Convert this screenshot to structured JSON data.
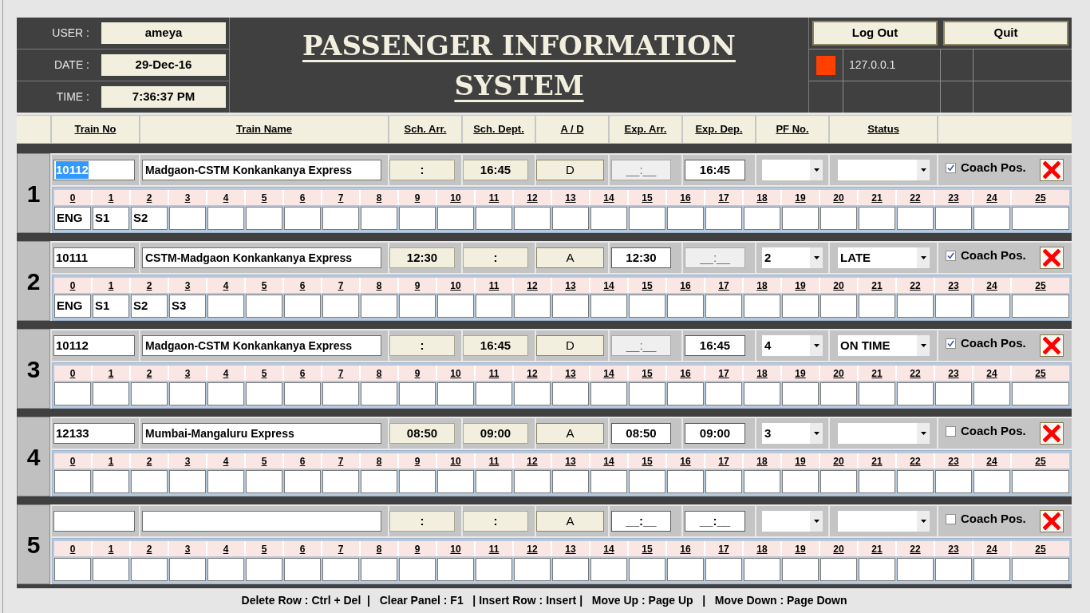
{
  "session": [
    {
      "label": "USER :",
      "value": "ameya"
    },
    {
      "label": "DATE :",
      "value": "29-Dec-16"
    },
    {
      "label": "TIME :",
      "value": "7:36:37 PM"
    }
  ],
  "title": "PASSENGER INFORMATION SYSTEM",
  "buttons": [
    "Log Out",
    "Quit"
  ],
  "server_address": "127.0.0.1",
  "columns": [
    "Train No",
    "Train Name",
    "Sch. Arr.",
    "Sch. Dept.",
    "A / D",
    "Exp. Arr.",
    "Exp. Dep.",
    "PF No.",
    "Status"
  ],
  "trains": [
    {
      "row_number": "1",
      "train_no": {
        "value": "10112",
        "highlighted": true
      },
      "train_name": "Madgaon-CSTM Konkankanya Express",
      "sch_arr": ":",
      "sch_dept": "16:45",
      "arrival_departure": "D",
      "exp_arr": {
        "value": "__:__",
        "disabled": true
      },
      "exp_dep": {
        "value": "16:45",
        "disabled": false
      },
      "coach_pos": {
        "label": "Coach Pos.",
        "checked": true
      },
      "coach_numbers": [
        "0",
        "1",
        "2",
        "3",
        "4",
        "5",
        "6",
        "7",
        "8",
        "9",
        "10",
        "11",
        "12",
        "13",
        "14",
        "15",
        "16",
        "17",
        "18",
        "19",
        "20",
        "21",
        "22",
        "23",
        "24",
        "25"
      ],
      "coaches": [
        "ENG",
        "S1",
        "S2"
      ]
    },
    {
      "row_number": "2",
      "train_no": {
        "value": "10111",
        "highlighted": false
      },
      "train_name": "CSTM-Madgaon Konkankanya Express",
      "sch_arr": "12:30",
      "sch_dept": ":",
      "arrival_departure": "A",
      "exp_arr": {
        "value": "12:30",
        "disabled": false
      },
      "exp_dep": {
        "value": "__:__",
        "disabled": true
      },
      "pf_no": "2",
      "status": "LATE",
      "coach_pos": {
        "label": "Coach Pos.",
        "checked": true
      },
      "coach_numbers": [
        "0",
        "1",
        "2",
        "3",
        "4",
        "5",
        "6",
        "7",
        "8",
        "9",
        "10",
        "11",
        "12",
        "13",
        "14",
        "15",
        "16",
        "17",
        "18",
        "19",
        "20",
        "21",
        "22",
        "23",
        "24",
        "25"
      ],
      "coaches": [
        "ENG",
        "S1",
        "S2",
        "S3"
      ]
    },
    {
      "row_number": "3",
      "train_no": {
        "value": "10112",
        "highlighted": false
      },
      "train_name": "Madgaon-CSTM Konkankanya Express",
      "sch_arr": ":",
      "sch_dept": "16:45",
      "arrival_departure": "D",
      "exp_arr": {
        "value": "__:__",
        "disabled": true
      },
      "exp_dep": {
        "value": "16:45",
        "disabled": false
      },
      "pf_no": "4",
      "status": "ON TIME",
      "coach_pos": {
        "label": "Coach Pos.",
        "checked": true
      },
      "coach_numbers": [
        "0",
        "1",
        "2",
        "3",
        "4",
        "5",
        "6",
        "7",
        "8",
        "9",
        "10",
        "11",
        "12",
        "13",
        "14",
        "15",
        "16",
        "17",
        "18",
        "19",
        "20",
        "21",
        "22",
        "23",
        "24",
        "25"
      ]
    },
    {
      "row_number": "4",
      "train_no": {
        "value": "12133",
        "highlighted": false
      },
      "train_name": "Mumbai-Mangaluru Express",
      "sch_arr": "08:50",
      "sch_dept": "09:00",
      "arrival_departure": "A",
      "exp_arr": {
        "value": "08:50",
        "disabled": false
      },
      "exp_dep": {
        "value": "09:00",
        "disabled": false
      },
      "pf_no": "3",
      "coach_pos": {
        "label": "Coach Pos.",
        "checked": false
      },
      "coach_numbers": [
        "0",
        "1",
        "2",
        "3",
        "4",
        "5",
        "6",
        "7",
        "8",
        "9",
        "10",
        "11",
        "12",
        "13",
        "14",
        "15",
        "16",
        "17",
        "18",
        "19",
        "20",
        "21",
        "22",
        "23",
        "24",
        "25"
      ]
    },
    {
      "row_number": "5",
      "sch_arr": ":",
      "sch_dept": ":",
      "arrival_departure": "A",
      "exp_arr": {
        "value": "__:__",
        "disabled": false
      },
      "exp_dep": {
        "value": "__:__",
        "disabled": false
      },
      "coach_pos": {
        "label": "Coach Pos.",
        "checked": false
      },
      "coach_numbers": [
        "0",
        "1",
        "2",
        "3",
        "4",
        "5",
        "6",
        "7",
        "8",
        "9",
        "10",
        "11",
        "12",
        "13",
        "14",
        "15",
        "16",
        "17",
        "18",
        "19",
        "20",
        "21",
        "22",
        "23",
        "24",
        "25"
      ]
    }
  ],
  "footer": "Delete Row : Ctrl + Del  |   Clear Panel : F1   | Insert Row : Insert |   Move Up : Page Up   |   Move Down : Page Down"
}
